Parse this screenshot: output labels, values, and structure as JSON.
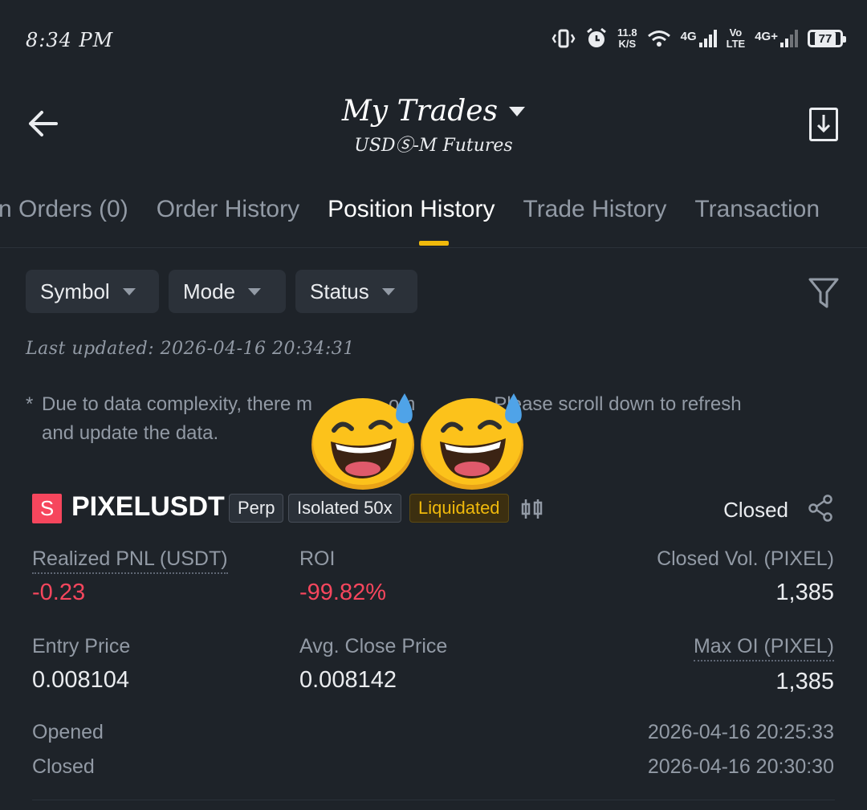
{
  "status_bar": {
    "time": "8:34 PM",
    "speed_value": "11.8",
    "speed_unit": "K/S",
    "net1": "4G",
    "net2_top": "Vo",
    "net2_bottom": "LTE",
    "net3": "4G+",
    "battery": "77"
  },
  "header": {
    "title": "My Trades",
    "subtitle": "USDⓈ-M Futures"
  },
  "tabs": [
    {
      "label": "n Orders (0)"
    },
    {
      "label": "Order History"
    },
    {
      "label": "Position History"
    },
    {
      "label": "Trade History"
    },
    {
      "label": "Transaction"
    }
  ],
  "filters": [
    {
      "label": "Symbol"
    },
    {
      "label": "Mode"
    },
    {
      "label": "Status"
    }
  ],
  "last_updated": "Last updated: 2026-04-16 20:34:31",
  "notice": {
    "star": "*",
    "line1_left": "Due to data complexity, there m",
    "line1_mid": "om",
    "line1_right": "Please scroll down to refresh",
    "line2": "and update the data."
  },
  "position": {
    "symbol_badge": "S",
    "symbol": "PIXELUSDT",
    "tags": [
      "Perp",
      "Isolated 50x",
      "Liquidated"
    ],
    "status": "Closed",
    "realized_pnl_label": "Realized PNL (USDT)",
    "realized_pnl": "-0.23",
    "roi_label": "ROI",
    "roi": "-99.82%",
    "closed_vol_label": "Closed Vol. (PIXEL)",
    "closed_vol": "1,385",
    "entry_price_label": "Entry Price",
    "entry_price": "0.008104",
    "avg_close_label": "Avg. Close Price",
    "avg_close": "0.008142",
    "max_oi_label": "Max OI (PIXEL)",
    "max_oi": "1,385",
    "opened_label": "Opened",
    "opened": "2026-04-16 20:25:33",
    "closed_label": "Closed",
    "closed": "2026-04-16 20:30:30"
  },
  "colors": {
    "background": "#1e2329",
    "accent": "#f0b90b",
    "negative": "#f6465d",
    "muted": "#929aa5"
  },
  "icons": [
    "vibrate-icon",
    "alarm-icon",
    "wifi-icon",
    "signal-icon",
    "battery-icon",
    "back-arrow-icon",
    "download-icon",
    "filter-icon",
    "chart-icon",
    "share-icon",
    "sweat-smile-emoji"
  ]
}
